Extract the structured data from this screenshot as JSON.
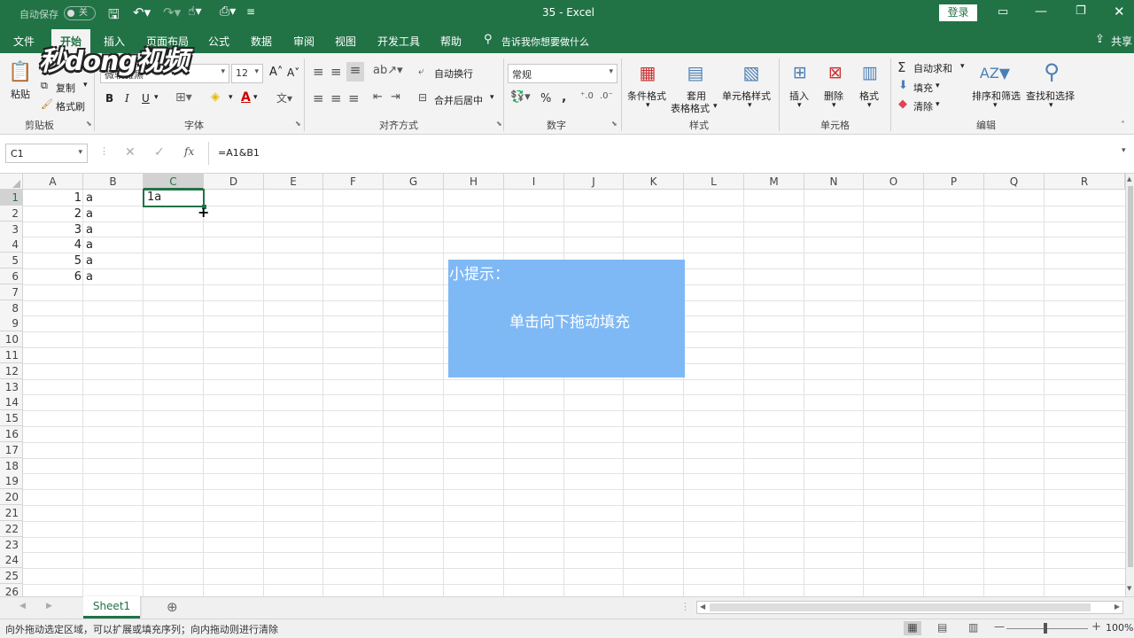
{
  "titlebar": {
    "autosave_label": "自动保存",
    "autosave_state": "关",
    "doc_title": "35  -  Excel",
    "login_label": "登录"
  },
  "tabs": [
    {
      "label": "文件"
    },
    {
      "label": "开始"
    },
    {
      "label": "插入"
    },
    {
      "label": "页面布局"
    },
    {
      "label": "公式"
    },
    {
      "label": "数据"
    },
    {
      "label": "审阅"
    },
    {
      "label": "视图"
    },
    {
      "label": "开发工具"
    },
    {
      "label": "帮助"
    }
  ],
  "tell_me": "告诉我你想要做什么",
  "share_label": "共享",
  "watermark": "秒dong视频",
  "ribbon": {
    "clipboard": {
      "paste": "粘贴",
      "copy": "复制",
      "format_painter": "格式刷",
      "group": "剪贴板"
    },
    "font": {
      "name": "微软雅黑",
      "size": "12",
      "bold": "B",
      "italic": "I",
      "underline": "U",
      "group": "字体"
    },
    "alignment": {
      "wrap": "自动换行",
      "merge": "合并后居中",
      "group": "对齐方式"
    },
    "number": {
      "format": "常规",
      "percent": "%",
      "comma": ",",
      "group": "数字"
    },
    "styles": {
      "conditional": "条件格式",
      "table_line1": "套用",
      "table_line2": "表格格式",
      "cell_styles": "单元格样式",
      "group": "样式"
    },
    "cells": {
      "insert": "插入",
      "delete": "删除",
      "format": "格式",
      "group": "单元格"
    },
    "editing": {
      "autosum": "自动求和",
      "fill": "填充",
      "clear": "清除",
      "sort": "排序和筛选",
      "find": "查找和选择",
      "group": "编辑"
    }
  },
  "formula_bar": {
    "name_box": "C1",
    "fx": "fx",
    "formula": "=A1&B1"
  },
  "columns": [
    "A",
    "B",
    "C",
    "D",
    "E",
    "F",
    "G",
    "H",
    "I",
    "J",
    "K",
    "L",
    "M",
    "N",
    "O",
    "P",
    "Q",
    "R"
  ],
  "rows": [
    "1",
    "2",
    "3",
    "4",
    "5",
    "6",
    "7",
    "8",
    "9",
    "10",
    "11",
    "12",
    "13",
    "14",
    "15",
    "16",
    "17",
    "18",
    "19",
    "20",
    "21",
    "22",
    "23",
    "24",
    "25",
    "26"
  ],
  "cells": {
    "A": [
      "1",
      "2",
      "3",
      "4",
      "5",
      "6"
    ],
    "B": [
      "a",
      "a",
      "a",
      "a",
      "a",
      "a"
    ],
    "C1": "1a"
  },
  "tip": {
    "title": "小提示：",
    "body": "单击向下拖动填充"
  },
  "sheet_tab": "Sheet1",
  "status_text": "向外拖动选定区域，可以扩展或填充序列；向内拖动则进行清除",
  "zoom": "100%"
}
